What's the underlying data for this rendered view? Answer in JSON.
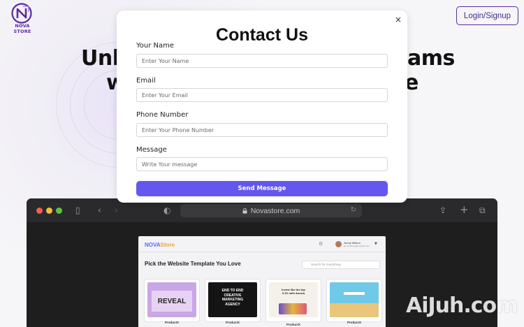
{
  "brand": {
    "name": "NOVA STORE",
    "accent": "#5a2ca0"
  },
  "header": {
    "login_label": "Login/Signup"
  },
  "hero": {
    "line1_left": "Unl",
    "line1_right": "ams",
    "line2_left": "w",
    "line2_right": "e"
  },
  "browser": {
    "url": "Novastore.com",
    "lock_icon": "lock-icon",
    "site": {
      "logo_left": "NOVA",
      "logo_right": "Store",
      "title": "Pick the Website Template You Love",
      "search_placeholder": "Search for everything",
      "user_name": "Jenny Wilson",
      "user_email": "jenny.wilson@example.com",
      "cards": [
        {
          "label": "ProductX",
          "text": "REVEAL"
        },
        {
          "label": "ProductX",
          "text": "END TO END CREATIVE MARKETING AGENCY"
        },
        {
          "label": "ProductX",
          "text": "Invest like the top 0.1% with Aurora"
        },
        {
          "label": "ProductX",
          "text": ""
        }
      ]
    }
  },
  "modal": {
    "title": "Contact Us",
    "close_glyph": "×",
    "fields": {
      "name": {
        "label": "Your Name",
        "placeholder": "Enter Your Name"
      },
      "email": {
        "label": "Email",
        "placeholder": "Enter Your Email"
      },
      "phone": {
        "label": "Phone Number",
        "placeholder": "Enter Your Phone Number"
      },
      "message": {
        "label": "Message",
        "placeholder": "Write Your message"
      }
    },
    "submit_label": "Send Message",
    "submit_color": "#6457f0"
  },
  "watermark": "AiJuh.com"
}
